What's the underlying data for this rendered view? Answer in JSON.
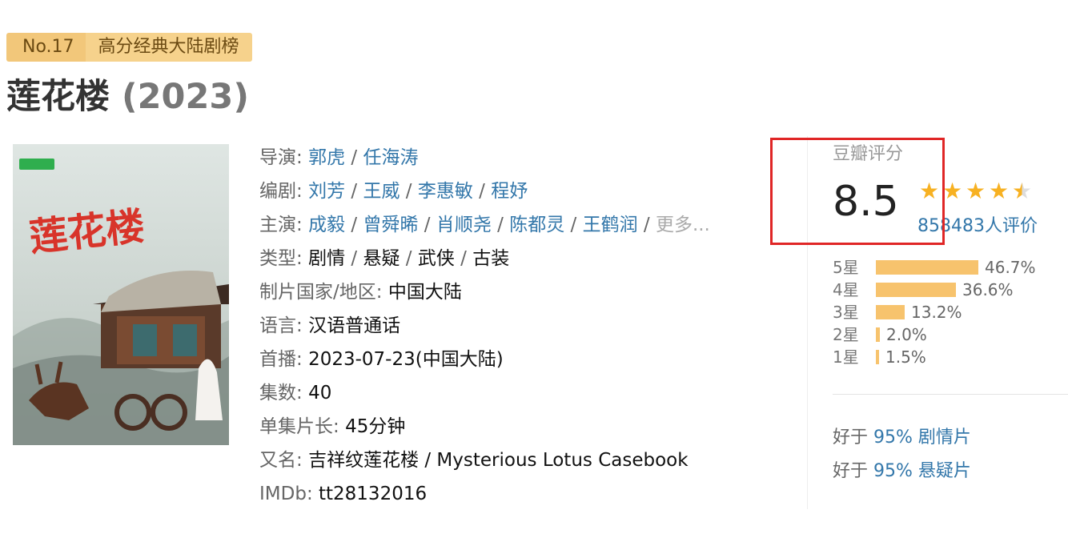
{
  "rank": {
    "number": "No.17",
    "list": "高分经典大陆剧榜"
  },
  "title": {
    "name": "莲花楼",
    "year": "(2023)"
  },
  "poster": {
    "calligraphy": "莲花楼"
  },
  "info": {
    "director_label": "导演: ",
    "directors": [
      "郭虎",
      "任海涛"
    ],
    "writer_label": "编剧: ",
    "writers": [
      "刘芳",
      "王威",
      "李惠敏",
      "程妤"
    ],
    "cast_label": "主演: ",
    "cast": [
      "成毅",
      "曾舜晞",
      "肖顺尧",
      "陈都灵",
      "王鹤润"
    ],
    "more": "更多...",
    "genre_label": "类型: ",
    "genres": [
      "剧情",
      "悬疑",
      "武侠",
      "古装"
    ],
    "country_label": "制片国家/地区: ",
    "country": "中国大陆",
    "language_label": "语言: ",
    "language": "汉语普通话",
    "premiere_label": "首播: ",
    "premiere": "2023-07-23(中国大陆)",
    "episodes_label": "集数: ",
    "episodes": "40",
    "runtime_label": "单集片长: ",
    "runtime": "45分钟",
    "aka_label": "又名: ",
    "aka": "吉祥纹莲花楼 / Mysterious Lotus Casebook",
    "imdb_label": "IMDb: ",
    "imdb": "tt28132016",
    "sep": " / "
  },
  "rating": {
    "label": "豆瓣评分",
    "score": "8.5",
    "stars_value": 4.5,
    "votes": "858483人评价",
    "distribution": [
      {
        "star": "5星",
        "percent": "46.7%",
        "value": 46.7
      },
      {
        "star": "4星",
        "percent": "36.6%",
        "value": 36.6
      },
      {
        "star": "3星",
        "percent": "13.2%",
        "value": 13.2
      },
      {
        "star": "2星",
        "percent": "2.0%",
        "value": 2.0
      },
      {
        "star": "1星",
        "percent": "1.5%",
        "value": 1.5
      }
    ]
  },
  "better_than": [
    {
      "prefix": "好于 ",
      "percent": "95%",
      "genre": " 剧情片"
    },
    {
      "prefix": "好于 ",
      "percent": "95%",
      "genre": " 悬疑片"
    }
  ],
  "colors": {
    "link": "#3377aa",
    "star": "#f7b122",
    "bar": "#f7c36d",
    "highlight": "#e02626",
    "badge": "#f2c77a"
  }
}
